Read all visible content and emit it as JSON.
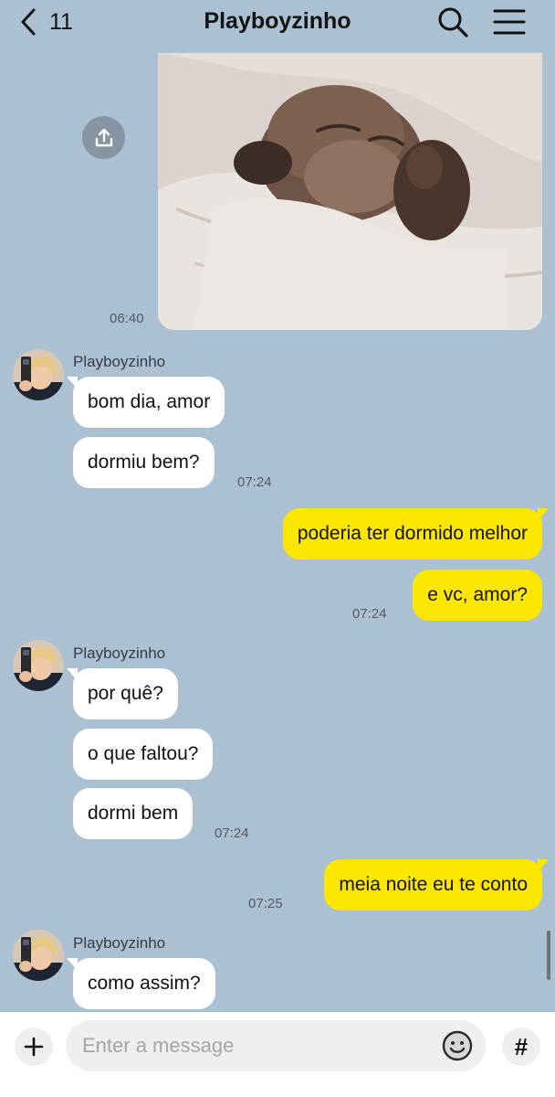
{
  "header": {
    "back_count": "11",
    "title": "Playboyzinho"
  },
  "colors": {
    "background": "#abc1d1",
    "incoming_bubble": "#ffffff",
    "outgoing_bubble": "#fde701",
    "timestamp": "#4f5b65"
  },
  "icons": {
    "back": "chevron-left-icon",
    "search": "search-icon",
    "menu": "menu-icon",
    "share": "share-icon",
    "add": "plus-icon",
    "emoji": "emoji-icon",
    "hashtag": "hashtag-icon"
  },
  "messages": {
    "photo": {
      "time": "06:40"
    },
    "group1": {
      "sender": "Playboyzinho",
      "msg1": "bom dia, amor",
      "msg2": "dormiu bem?",
      "time": "07:24"
    },
    "group2": {
      "msg1": "poderia ter dormido melhor",
      "msg2": "e vc, amor?",
      "time": "07:24"
    },
    "group3": {
      "sender": "Playboyzinho",
      "msg1": "por quê?",
      "msg2": "o que faltou?",
      "msg3": "dormi bem",
      "time": "07:24"
    },
    "group4": {
      "msg1": "meia noite eu te conto",
      "time": "07:25"
    },
    "group5": {
      "sender": "Playboyzinho",
      "msg1": "como assim?"
    }
  },
  "composer": {
    "placeholder": "Enter a message",
    "value": ""
  }
}
